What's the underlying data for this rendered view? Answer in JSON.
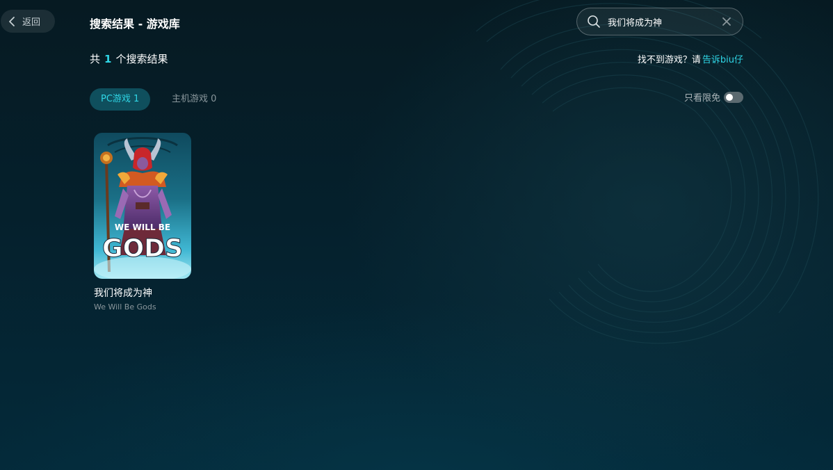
{
  "header": {
    "back_label": "返回",
    "title": "搜索结果 - 游戏库"
  },
  "search": {
    "value": "我们将成为神",
    "placeholder": ""
  },
  "results": {
    "prefix": "共",
    "count": "1",
    "suffix": "个搜索结果"
  },
  "feedback": {
    "text": "找不到游戏？请",
    "link": "告诉biu仔"
  },
  "tabs": [
    {
      "label": "PC游戏 1",
      "active": true
    },
    {
      "label": "主机游戏 0",
      "active": false
    }
  ],
  "filter": {
    "free_only_label": "只看限免",
    "free_only_on": false
  },
  "games": [
    {
      "title": "我们将成为神",
      "subtitle": "We Will Be Gods",
      "cover_logo_line1": "WE WILL BE",
      "cover_logo_line2": "GODS"
    }
  ],
  "colors": {
    "accent": "#2fd6e6",
    "active_tab_bg": "#0f4f5d",
    "background": "#05202c"
  },
  "icons": {
    "back": "chevron-left-icon",
    "search": "search-icon",
    "clear": "close-icon"
  }
}
